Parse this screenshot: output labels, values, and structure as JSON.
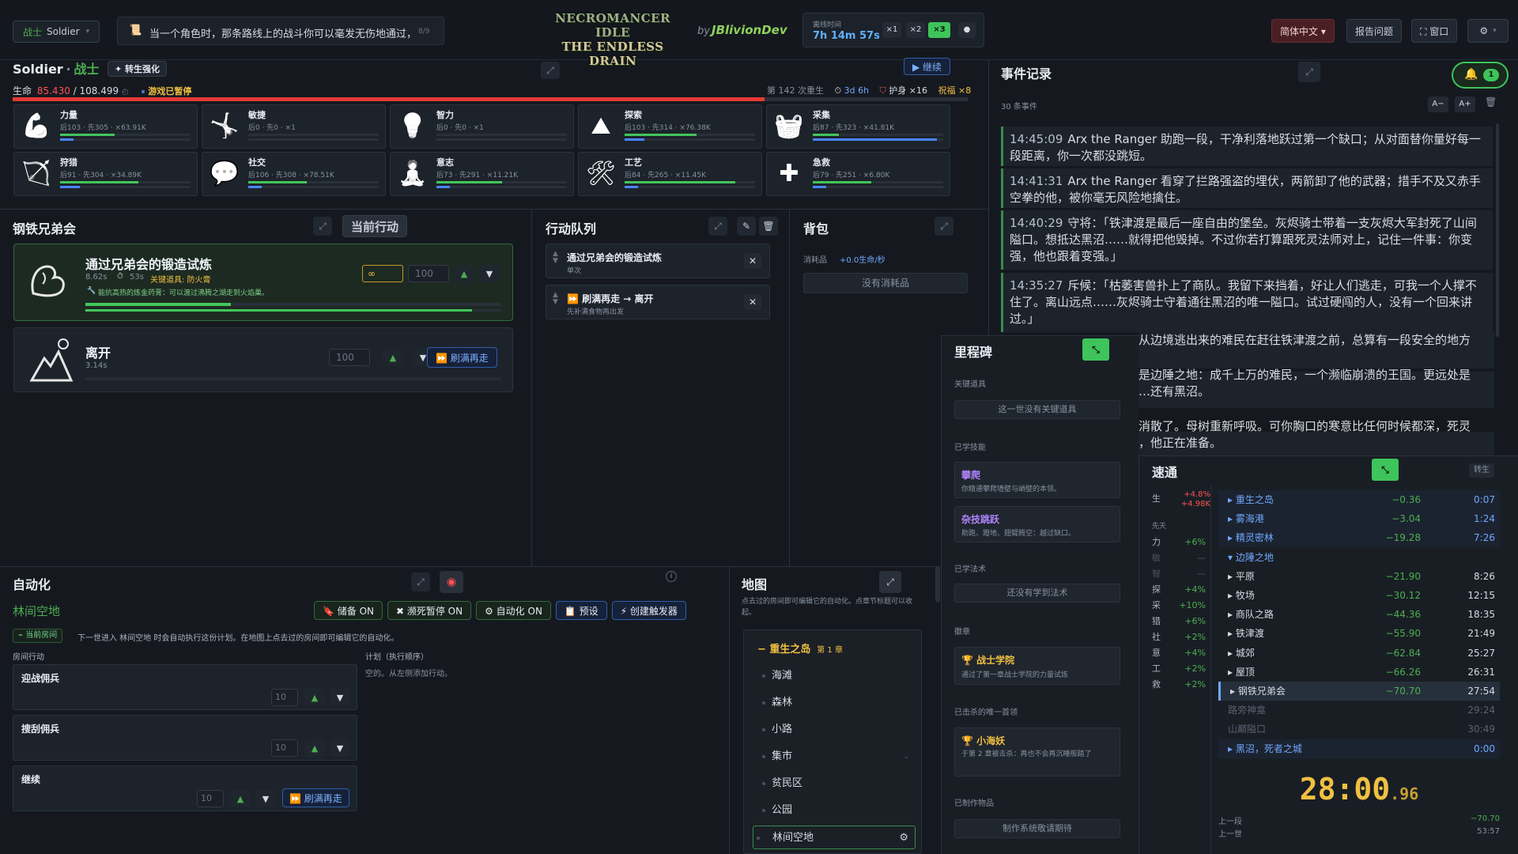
{
  "topbar": {
    "class_chip": {
      "cn": "战士",
      "en": "Soldier",
      "caret": "▾"
    },
    "tip_text": "当一个角色时，那条路线上的战斗你可以毫发无伤地通过，降",
    "tip_count": "8/9",
    "logo_line1": "NECROMANCER IDLE",
    "logo_line2": "THE ENDLESS DRAIN",
    "by": "by",
    "author": "JBlivionDev",
    "offline_label": "离线时间",
    "offline_time": "7h 14m 57s",
    "speeds": [
      "×1",
      "×2",
      "×3"
    ],
    "lang": "简体中文 ▾",
    "report": "报告问题",
    "window": "⛶ 窗口",
    "settings_caret": "▾"
  },
  "character": {
    "name_en": "Soldier",
    "sep": "·",
    "name_cn": "战士",
    "rebirth_btn": "✦ 转生强化",
    "continue_btn": "▶ 继续",
    "life_label": "生命",
    "life_cur": "85.430",
    "life_max": "/ 108.499",
    "life_fraction": 0.787,
    "paused": "游戏已暂停",
    "rebirth_count": "第 142 次重生",
    "time": "3d 6h",
    "ward": "护身 ×16",
    "blessing": "祝福 ×8"
  },
  "skills": [
    {
      "icon": "strength-icon",
      "name": "力量",
      "stats": "后103 · 先305 · ×63.91K",
      "b1": 0.42,
      "b2": 0.1,
      "c2": "#4a86ff"
    },
    {
      "icon": "agility-icon",
      "name": "敏捷",
      "stats": "后0 · 先0 · ×1",
      "b1": 0.0,
      "b2": 0.0,
      "c2": "#4a86ff"
    },
    {
      "icon": "intellect-icon",
      "name": "智力",
      "stats": "后0 · 先0 · ×1",
      "b1": 0.0,
      "b2": 0.0,
      "c2": "#4a86ff"
    },
    {
      "icon": "explore-icon",
      "name": "探索",
      "stats": "后103 · 先314 · ×76.38K",
      "b1": 0.55,
      "b2": 0.15,
      "c2": "#4a86ff"
    },
    {
      "icon": "gather-icon",
      "name": "采集",
      "stats": "后87 · 先323 · ×41.81K",
      "b1": 0.2,
      "b2": 0.95,
      "c2": "#4a86ff"
    },
    {
      "icon": "hunt-icon",
      "name": "狩猎",
      "stats": "后91 · 先304 · ×34.89K",
      "b1": 0.6,
      "b2": 0.15,
      "c2": "#4a86ff"
    },
    {
      "icon": "social-icon",
      "name": "社交",
      "stats": "后106 · 先308 · ×78.51K",
      "b1": 0.45,
      "b2": 0.1,
      "c2": "#4a86ff"
    },
    {
      "icon": "will-icon",
      "name": "意志",
      "stats": "后73 · 先291 · ×11.21K",
      "b1": 0.5,
      "b2": 0.1,
      "c2": "#4a86ff"
    },
    {
      "icon": "craft-icon",
      "name": "工艺",
      "stats": "后84 · 先265 · ×11.45K",
      "b1": 0.85,
      "b2": 0.1,
      "c2": "#4a86ff"
    },
    {
      "icon": "firstaid-icon",
      "name": "急救",
      "stats": "后79 · 先251 · ×6.80K",
      "b1": 0.45,
      "b2": 0.1,
      "c2": "#4a86ff"
    }
  ],
  "actions_panel": {
    "location": "钢铁兄弟会",
    "tab": "当前行动",
    "items": [
      {
        "name": "通过兄弟会的锻造试炼",
        "time": "8.62s",
        "eta": "53s",
        "key_item": "关键道具: 防火膏",
        "note": "能抗高热的炼金药膏：可以渡过沸腾之湖走到火焰巢。",
        "infinity": "∞",
        "qty": "100",
        "progress": 0.35,
        "progress2": 0.93
      },
      {
        "name": "离开",
        "time": "3.14s",
        "qty": "100",
        "repeat": "⏩ 刷满再走"
      }
    ]
  },
  "queue": {
    "title": "行动队列",
    "items": [
      {
        "name": "通过兄弟会的锻造试炼",
        "sub": "单次"
      },
      {
        "name": "⏩ 刷满再走 → 离开",
        "sub": "先补满食物再出发"
      }
    ]
  },
  "backpack": {
    "title": "背包",
    "consumable_label": "消耗品",
    "rate": "+0.0生命/秒",
    "empty": "没有消耗品"
  },
  "automation": {
    "title": "自动化",
    "room": "林间空地",
    "buttons": [
      "🔖 储备 ON",
      "✖ 濒死暂停 ON",
      "⚙ 自动化 ON",
      "📋 预设",
      "⚡ 创建触发器"
    ],
    "current_room_tag": "⌁ 当前房间",
    "desc": "下一世进入 林间空地 时会自动执行这份计划。在地图上点去过的房间即可编辑它的自动化。",
    "room_actions_label": "房间行动",
    "plan_label": "计划（执行顺序）",
    "plan_empty": "空的。从左侧添加行动。",
    "room_actions": [
      {
        "name": "迎战佣兵",
        "qty": "10"
      },
      {
        "name": "搜刮佣兵",
        "qty": "10"
      },
      {
        "name": "继续",
        "qty": "10",
        "repeat": "⏩ 刷满再走"
      }
    ]
  },
  "map": {
    "title": "地图",
    "desc": "点去过的房间即可编辑它的自动化。点章节标题可以收起。",
    "chapter": "− 重生之岛",
    "chapter_tag": "第 1 章",
    "rooms": [
      "海滩",
      "森林",
      "小路",
      "集市",
      "贫民区",
      "公园",
      "林间空地"
    ]
  },
  "events": {
    "title": "事件记录",
    "count": "30 条事件",
    "bell_count": "1",
    "font_minus": "A−",
    "font_plus": "A+",
    "entries": [
      {
        "t": "14:45:09",
        "text": "Arx the Ranger 助跑一段，干净利落地跃过第一个缺口；从对面替你量好每一段距离，你一次都没跳短。"
      },
      {
        "t": "14:41:31",
        "text": "Arx the Ranger 看穿了拦路强盗的埋伏，两箭卸了他的武器；措手不及又赤手空拳的他，被你毫无风险地擒住。"
      },
      {
        "t": "14:40:29",
        "text": "守将：「铁津渡是最后一座自由的堡垒。灰烬骑士带着一支灰烬大军封死了山间隘口。想抵达黑沼……就得把他毁掉。不过你若打算跟死灵法师对上，记住一件事：你变强，他也跟着变强。」"
      },
      {
        "t": "14:35:27",
        "text": "斥候：「枯萎害兽扑上了商队。我留下来挡着，好让人们逃走，可我一个人撑不住了。离山远点……灰烬骑士守着通往黑沼的唯一隘口。试过硬闯的人，没有一个回来讲过。」"
      }
    ],
    "hidden_partials": [
      "从边境逃出来的难民在赶往铁津渡之前，总算有一段安全的地方",
      "是边陲之地：成千上万的难民，一个濒临崩溃的王国。更远处是",
      "…还有黑沼。",
      "消散了。母树重新呼吸。可你胸口的寒意比任何时候都深，死灵",
      "，他正在准备。"
    ]
  },
  "milestones": {
    "title": "里程碑",
    "key_items_label": "关键道具",
    "key_items_empty": "这一世没有关键道具",
    "skills_label": "已学技能",
    "learned": [
      {
        "name": "攀爬",
        "desc": "你精通攀爬墙壁与峭壁的本领。"
      },
      {
        "name": "杂技跳跃",
        "desc": "助跑、蹬地、翅臂腾空：越过缺口。"
      }
    ],
    "spells_label": "已学法术",
    "spells_empty": "还没有学到法术",
    "badges_label": "徽章",
    "badge": {
      "name": "🏆 战士学院",
      "desc": "通过了第一章战士学院的力量试炼"
    },
    "bosses_label": "已击杀的唯一首领",
    "boss": {
      "name": "🏆 小海妖",
      "desc": "于第 2 章被击杀：再也不会再沉睡般踏了"
    },
    "crafted_label": "已制作物品",
    "crafted_empty": "制作系统敬请期待"
  },
  "speedrun": {
    "title": "速通",
    "rebirth_tag": "转生",
    "stats_top": [
      {
        "k": "生",
        "v": "+4.8%",
        "v2": "+4.98K"
      }
    ],
    "first_label": "先天",
    "stats": [
      {
        "k": "力",
        "v": "+6%"
      },
      {
        "k": "敏",
        "v": "—"
      },
      {
        "k": "智",
        "v": "—"
      },
      {
        "k": "探",
        "v": "+4%"
      },
      {
        "k": "采",
        "v": "+10%"
      },
      {
        "k": "猎",
        "v": "+6%"
      },
      {
        "k": "社",
        "v": "+2%"
      },
      {
        "k": "意",
        "v": "+4%"
      },
      {
        "k": "工",
        "v": "+2%"
      },
      {
        "k": "救",
        "v": "+2%"
      }
    ],
    "rows": [
      {
        "name": "▸ 重生之岛",
        "d": "−0.36",
        "t": "0:07",
        "kind": "chapter"
      },
      {
        "name": "▸ 雾海港",
        "d": "−3.04",
        "t": "1:24",
        "kind": "chapter"
      },
      {
        "name": "▸ 精灵密林",
        "d": "−19.28",
        "t": "7:26",
        "kind": "chapter"
      },
      {
        "name": "▾ 边陲之地",
        "d": "",
        "t": "",
        "kind": "group"
      },
      {
        "name": "▸ 平原",
        "d": "−21.90",
        "t": "8:26",
        "kind": "room"
      },
      {
        "name": "▸ 牧场",
        "d": "−30.12",
        "t": "12:15",
        "kind": "room"
      },
      {
        "name": "▸ 商队之路",
        "d": "−44.36",
        "t": "18:35",
        "kind": "room"
      },
      {
        "name": "▸ 铁津渡",
        "d": "−55.90",
        "t": "21:49",
        "kind": "room"
      },
      {
        "name": "▸ 城郊",
        "d": "−62.84",
        "t": "25:27",
        "kind": "room"
      },
      {
        "name": "▸ 屋顶",
        "d": "−66.26",
        "t": "26:31",
        "kind": "room"
      },
      {
        "name": "▸ 钢铁兄弟会",
        "d": "−70.70",
        "t": "27:54",
        "kind": "current"
      },
      {
        "name": "路旁神龛",
        "d": "",
        "t": "29:24",
        "kind": "future"
      },
      {
        "name": "山巅隘口",
        "d": "",
        "t": "30:49",
        "kind": "future"
      },
      {
        "name": "▸ 黑沼，死者之城",
        "d": "",
        "t": "0:00",
        "kind": "chapter"
      }
    ],
    "timer": "28:00",
    "timer_ms": ".96",
    "prev_segment_label": "上一段",
    "prev_segment_val": "−70.70",
    "prev_life_label": "上一世",
    "prev_life_val": "53:57"
  }
}
